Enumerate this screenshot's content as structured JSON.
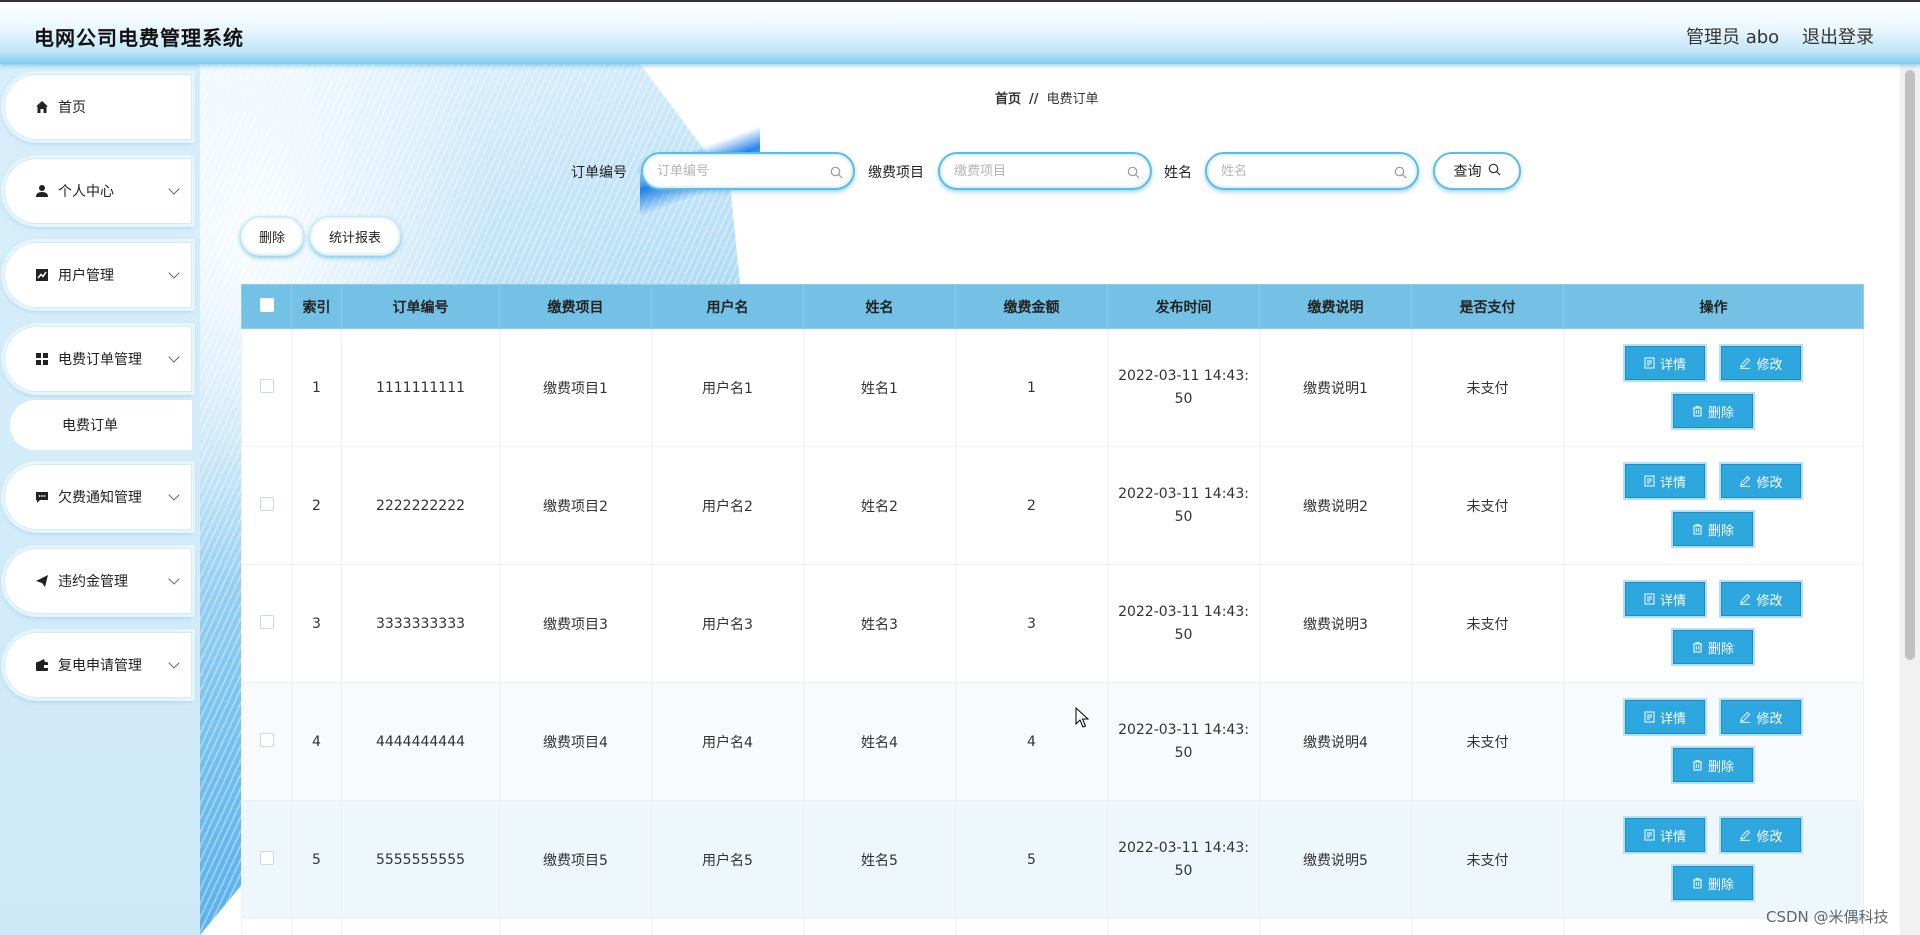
{
  "header": {
    "title": "电网公司电费管理系统",
    "admin": "管理员 abo",
    "logout": "退出登录"
  },
  "sidebar": {
    "items": [
      {
        "label": "首页",
        "icon": "home-icon"
      },
      {
        "label": "个人中心",
        "icon": "user-icon"
      },
      {
        "label": "用户管理",
        "icon": "chart-icon"
      },
      {
        "label": "电费订单管理",
        "icon": "grid-icon"
      },
      {
        "label": "欠费通知管理",
        "icon": "message-icon"
      },
      {
        "label": "违约金管理",
        "icon": "send-icon"
      },
      {
        "label": "复电申请管理",
        "icon": "wallet-icon"
      }
    ],
    "sub_item": "电费订单"
  },
  "breadcrumb": {
    "home": "首页",
    "sep": "//",
    "current": "电费订单"
  },
  "search": {
    "order_label": "订单编号",
    "order_placeholder": "订单编号",
    "item_label": "缴费项目",
    "item_placeholder": "缴费项目",
    "name_label": "姓名",
    "name_placeholder": "姓名",
    "query_label": "查询"
  },
  "actions": {
    "delete": "删除",
    "report": "统计报表"
  },
  "table": {
    "headers": [
      "索引",
      "订单编号",
      "缴费项目",
      "用户名",
      "姓名",
      "缴费金额",
      "发布时间",
      "缴费说明",
      "是否支付",
      "操作"
    ],
    "rows": [
      {
        "idx": "1",
        "order": "1111111111",
        "item": "缴费项目1",
        "user": "用户名1",
        "name": "姓名1",
        "amount": "1",
        "time": "2022-03-11 14:43:50",
        "desc": "缴费说明1",
        "paid": "未支付"
      },
      {
        "idx": "2",
        "order": "2222222222",
        "item": "缴费项目2",
        "user": "用户名2",
        "name": "姓名2",
        "amount": "2",
        "time": "2022-03-11 14:43:50",
        "desc": "缴费说明2",
        "paid": "未支付"
      },
      {
        "idx": "3",
        "order": "3333333333",
        "item": "缴费项目3",
        "user": "用户名3",
        "name": "姓名3",
        "amount": "3",
        "time": "2022-03-11 14:43:50",
        "desc": "缴费说明3",
        "paid": "未支付"
      },
      {
        "idx": "4",
        "order": "4444444444",
        "item": "缴费项目4",
        "user": "用户名4",
        "name": "姓名4",
        "amount": "4",
        "time": "2022-03-11 14:43:50",
        "desc": "缴费说明4",
        "paid": "未支付"
      },
      {
        "idx": "5",
        "order": "5555555555",
        "item": "缴费项目5",
        "user": "用户名5",
        "name": "姓名5",
        "amount": "5",
        "time": "2022-03-11 14:43:50",
        "desc": "缴费说明5",
        "paid": "未支付"
      }
    ],
    "ops": {
      "detail": "详情",
      "edit": "修改",
      "delete": "删除"
    }
  },
  "watermark": "CSDN @米偶科技",
  "colors": {
    "accent": "#2ea6de",
    "header_row": "#73c1e4",
    "border": "#5bbbe9"
  }
}
